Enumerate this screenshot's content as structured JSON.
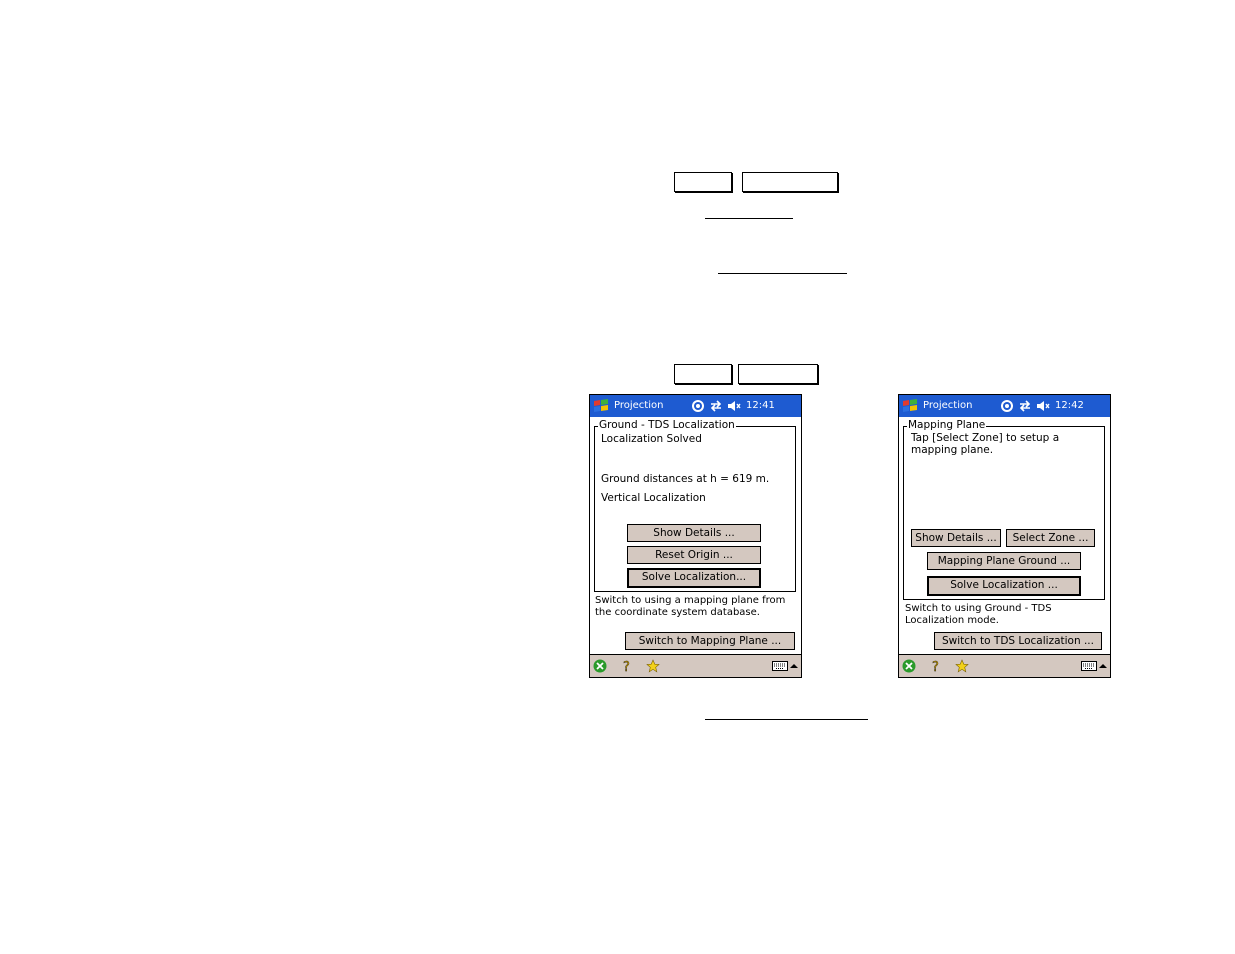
{
  "screen_left": {
    "title": "Projection",
    "time": "12:41",
    "group_title": "Ground - TDS Localization",
    "status_line": "Localization Solved",
    "ground_line": "Ground distances at h = 619  m.",
    "vertical_line": "Vertical Localization",
    "buttons": {
      "show_details": "Show Details ...",
      "reset_origin": "Reset Origin ...",
      "solve": "Solve Localization..."
    },
    "info_text": "Switch to using a mapping plane from the coordinate system database.",
    "switch_button": "Switch to Mapping Plane ..."
  },
  "screen_right": {
    "title": "Projection",
    "time": "12:42",
    "group_title": "Mapping Plane",
    "tap_text": "Tap [Select Zone] to setup a mapping plane.",
    "buttons": {
      "show_details": "Show Details ...",
      "select_zone": "Select Zone ...",
      "mapping_plane_ground": "Mapping Plane Ground ...",
      "solve": "Solve Localization ..."
    },
    "info_text": "Switch to using  Ground - TDS Localization mode.",
    "switch_button": "Switch to TDS Localization ..."
  },
  "icons": {
    "start": "windows-flag-icon",
    "connectivity": "connectivity-icon",
    "sync": "sync-arrows-icon",
    "speaker": "speaker-muted-icon",
    "ok": "close-ok-icon",
    "help": "help-icon",
    "favorites": "star-icon",
    "keyboard": "keyboard-icon",
    "sip_arrow": "up-arrow-icon"
  },
  "colors": {
    "titlebar": "#1e5bd1",
    "button_face": "#d4c8c0"
  }
}
